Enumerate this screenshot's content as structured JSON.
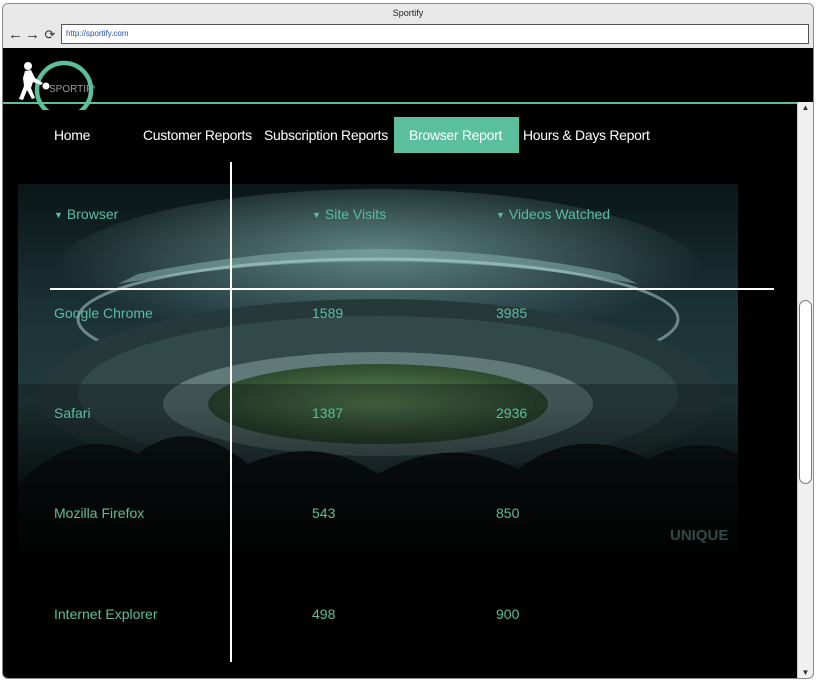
{
  "window": {
    "title": "Sportify",
    "url": "http://sportify.com"
  },
  "browser_nav": {
    "back": "←",
    "forward": "→",
    "reload": "⟳"
  },
  "logo": {
    "text": "SPORTIFY"
  },
  "menu": {
    "items": [
      {
        "label": "Home",
        "active": false
      },
      {
        "label": "Customer Reports",
        "active": false
      },
      {
        "label": "Subscription Reports",
        "active": false
      },
      {
        "label": "Browser Report",
        "active": true
      },
      {
        "label": "Hours & Days Report",
        "active": false
      }
    ]
  },
  "table": {
    "headers": [
      "Browser",
      "Site Visits",
      "Videos Watched"
    ],
    "rows": [
      [
        "Google Chrome",
        "1589",
        "3985"
      ],
      [
        "Safari",
        "1387",
        "2936"
      ],
      [
        "Mozilla Firefox",
        "543",
        "850"
      ],
      [
        "Internet Explorer",
        "498",
        "900"
      ]
    ]
  },
  "watermark": {
    "text": "UNIQUE"
  },
  "colors": {
    "accent": "#5bbf9d",
    "background": "#000000",
    "text": "#ffffff"
  },
  "icons": {
    "sort": "caret-down-icon"
  }
}
